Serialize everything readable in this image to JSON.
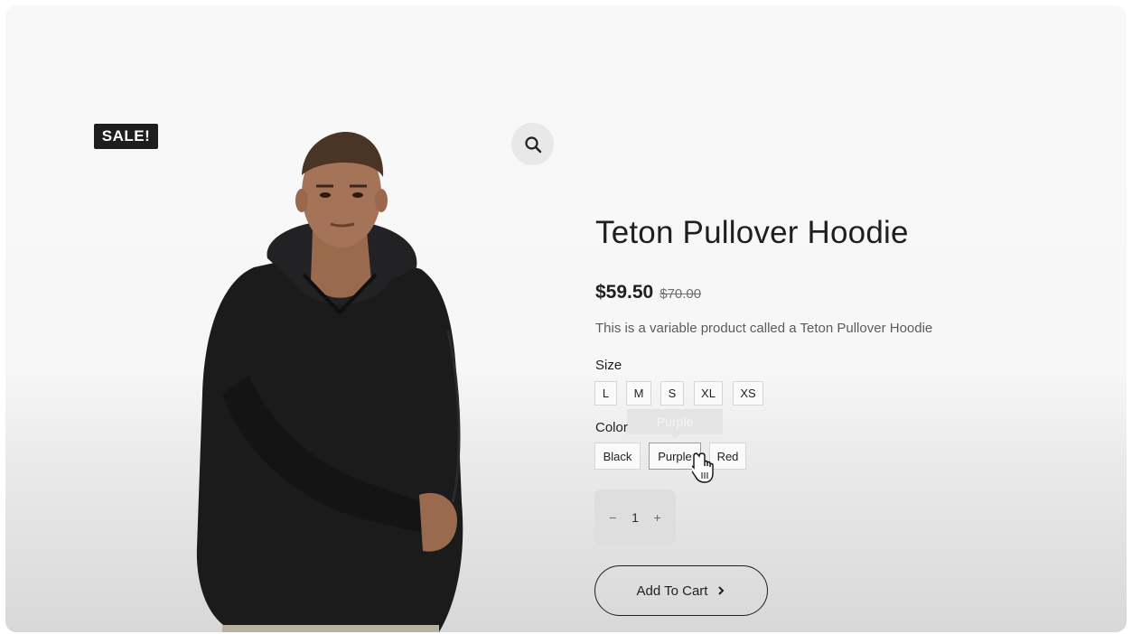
{
  "badge": {
    "sale": "SALE!"
  },
  "product": {
    "title": "Teton Pullover Hoodie",
    "price": "$59.50",
    "old_price": "$70.00",
    "description": "This is a variable product called a Teton Pullover Hoodie"
  },
  "size": {
    "label": "Size",
    "options": [
      "L",
      "M",
      "S",
      "XL",
      "XS"
    ]
  },
  "color": {
    "label": "Color",
    "options": [
      "Black",
      "Purple",
      "Red"
    ],
    "tooltip": "Purple"
  },
  "quantity": {
    "minus": "−",
    "value": "1",
    "plus": "+"
  },
  "cart": {
    "label": "Add To Cart"
  },
  "icons": {
    "zoom": "search-icon",
    "cart_arrow": "chevron-right-icon",
    "cursor": "hand-pointer-icon"
  },
  "colors": {
    "text": "#1f1f1f",
    "badge_bg": "#1e1e1e",
    "muted": "#5c5c5c"
  }
}
